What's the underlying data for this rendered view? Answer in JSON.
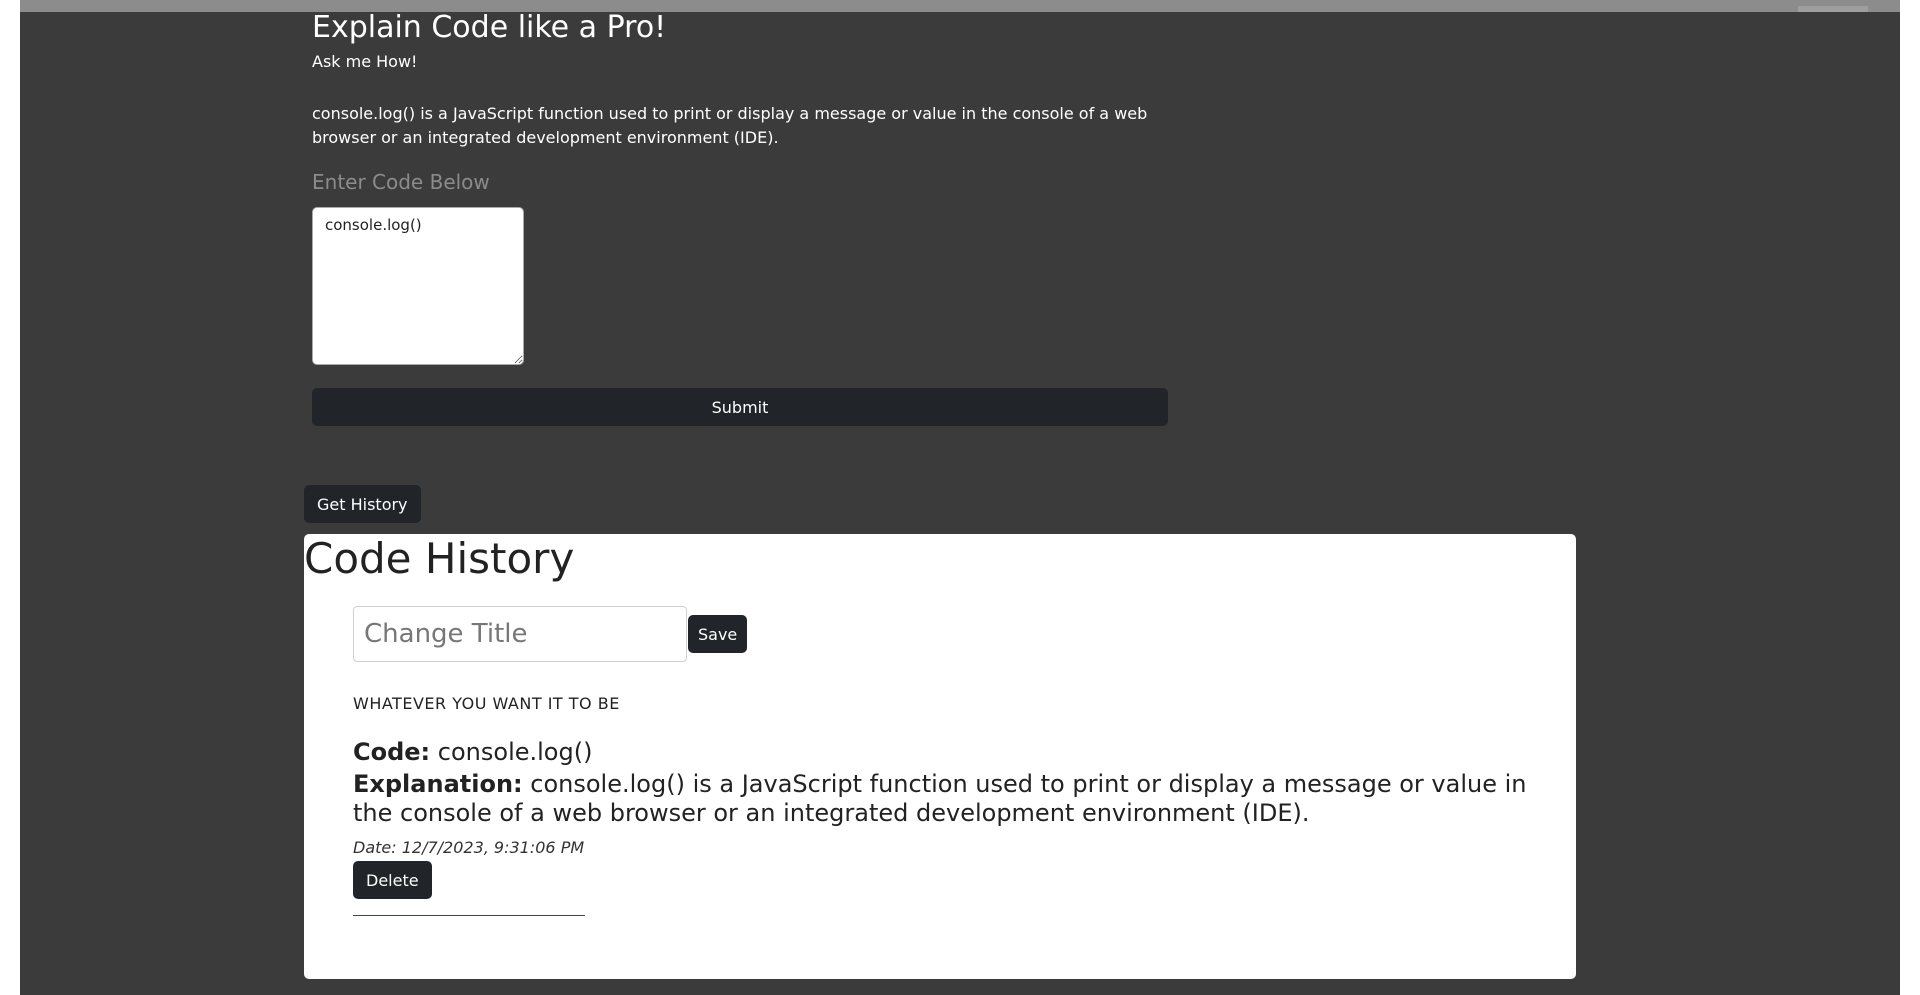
{
  "app": {
    "title": "Explain Code like a Pro!",
    "subtitle": "Ask me How!",
    "explanation_output": "console.log() is a JavaScript function used to print or display a message or value in the console of a web browser or an integrated development environment (IDE)."
  },
  "code_form": {
    "label": "Enter Code Below",
    "code_value": "console.log()",
    "submit_label": "Submit"
  },
  "history": {
    "get_history_label": "Get History",
    "heading": "Code History",
    "change_title_placeholder": "Change Title",
    "save_label": "Save",
    "entries": [
      {
        "title": "WHATEVER YOU WANT IT TO BE",
        "code_label": "Code:",
        "code": "console.log()",
        "explanation_label": "Explanation:",
        "explanation": "console.log() is a JavaScript function used to print or display a message or value in the console of a web browser or an integrated development environment (IDE).",
        "date": "Date: 12/7/2023, 9:31:06 PM",
        "delete_label": "Delete"
      }
    ]
  },
  "colors": {
    "page_background": "#3b3b3b",
    "button_background": "#212529",
    "panel_background": "#ffffff"
  }
}
